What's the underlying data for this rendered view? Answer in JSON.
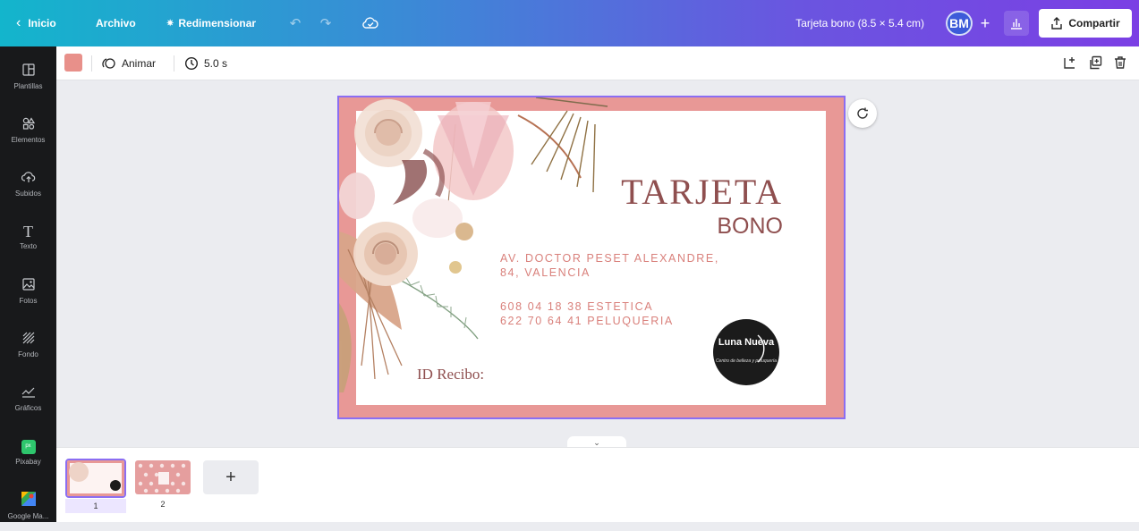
{
  "topbar": {
    "back_label": "Inicio",
    "file_label": "Archivo",
    "resize_label": "Redimensionar",
    "title": "Tarjeta bono (8.5 × 5.4 cm)",
    "avatar_initials": "BM",
    "share_label": "Compartir"
  },
  "sidebar": {
    "items": [
      {
        "label": "Plantillas",
        "icon": "layout-icon"
      },
      {
        "label": "Elementos",
        "icon": "shapes-icon"
      },
      {
        "label": "Subidos",
        "icon": "cloud-upload-icon"
      },
      {
        "label": "Texto",
        "icon": "text-icon"
      },
      {
        "label": "Fotos",
        "icon": "image-icon"
      },
      {
        "label": "Fondo",
        "icon": "background-icon"
      },
      {
        "label": "Gráficos",
        "icon": "chart-icon"
      },
      {
        "label": "Pixabay",
        "icon": "pixabay-icon"
      },
      {
        "label": "Google Ma...",
        "icon": "google-maps-icon"
      }
    ]
  },
  "toolbar": {
    "color_swatch": "#e8908a",
    "animate_label": "Animar",
    "duration_label": "5.0 s"
  },
  "card": {
    "title": "TARJETA",
    "subtitle": "BONO",
    "address_line1": "AV. DOCTOR PESET ALEXANDRE,",
    "address_line2": "84, VALENCIA",
    "phone_line1": "608 04 18 38 ESTETICA",
    "phone_line2": "622 70 64 41 PELUQUERIA",
    "id_label": "ID Recibo:",
    "logo_text": "Luna Nueva",
    "logo_subtext": "Centro de belleza y peluquería",
    "frame_color": "#e89896",
    "text_color": "#8f4f4f"
  },
  "pages": {
    "items": [
      {
        "number": "1"
      },
      {
        "number": "2"
      }
    ],
    "add_label": "+"
  }
}
